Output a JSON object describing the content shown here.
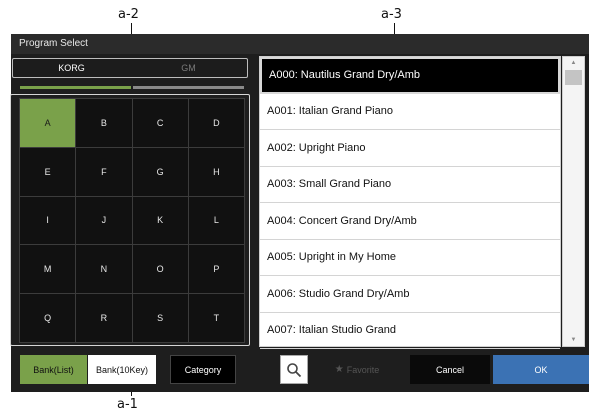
{
  "callouts": {
    "a1": "a-1",
    "a2": "a-2",
    "a3": "a-3"
  },
  "window": {
    "title": "Program Select"
  },
  "tabs": [
    {
      "label": "KORG",
      "active": true
    },
    {
      "label": "GM",
      "active": false
    }
  ],
  "bank_grid": {
    "cells": [
      "A",
      "B",
      "C",
      "D",
      "E",
      "F",
      "G",
      "H",
      "I",
      "J",
      "K",
      "L",
      "M",
      "N",
      "O",
      "P",
      "Q",
      "R",
      "S",
      "T"
    ],
    "selected": "A"
  },
  "program_list": {
    "items": [
      "A000: Nautilus Grand Dry/Amb",
      "A001: Italian Grand Piano",
      "A002: Upright Piano",
      "A003: Small Grand Piano",
      "A004: Concert Grand Dry/Amb",
      "A005: Upright in My Home",
      "A006: Studio Grand Dry/Amb",
      "A007: Italian Studio Grand"
    ],
    "selected_index": 0
  },
  "buttons": {
    "bank_list": "Bank(List)",
    "bank_10key": "Bank(10Key)",
    "category": "Category",
    "favorite": "Favorite",
    "cancel": "Cancel",
    "ok": "OK"
  },
  "icons": {
    "search": "search-icon",
    "favorite": "star-icon",
    "scroll_up": "arrow-up-icon",
    "scroll_down": "arrow-down-icon"
  },
  "colors": {
    "accent_green": "#7aa14a",
    "ok_blue": "#3b72b4",
    "panel": "#1e1e1e"
  }
}
